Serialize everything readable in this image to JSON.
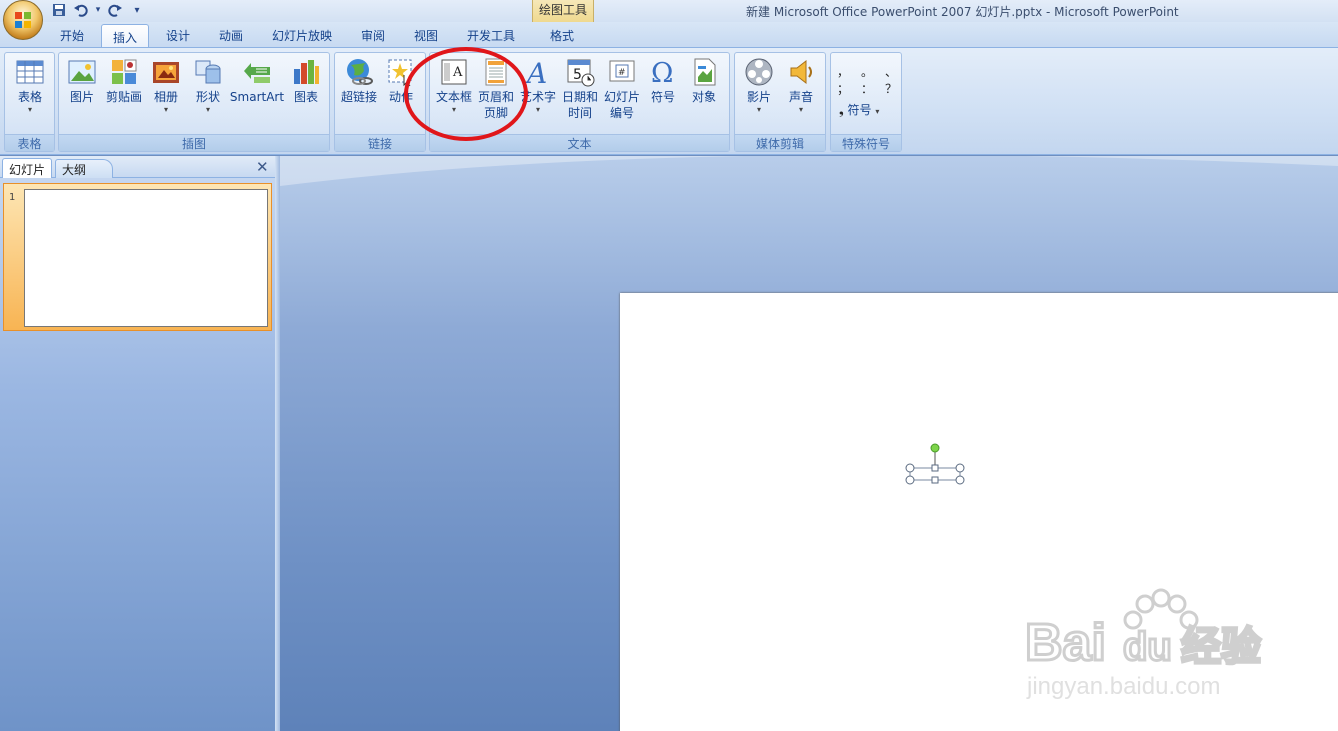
{
  "window": {
    "title": "新建 Microsoft Office PowerPoint 2007 幻灯片.pptx - Microsoft PowerPoint"
  },
  "quick_access": {
    "items": [
      "save-icon",
      "undo-icon",
      "redo-icon",
      "customize-icon"
    ],
    "dropdown": "▾"
  },
  "contextual_tab": {
    "label": "绘图工具",
    "color": "#efd98f"
  },
  "tabs": [
    {
      "label": "开始"
    },
    {
      "label": "插入",
      "active": true
    },
    {
      "label": "设计"
    },
    {
      "label": "动画"
    },
    {
      "label": "幻灯片放映"
    },
    {
      "label": "审阅"
    },
    {
      "label": "视图"
    },
    {
      "label": "开发工具"
    },
    {
      "label": "格式"
    }
  ],
  "ribbon": {
    "groups": [
      {
        "label": "表格",
        "buttons": [
          {
            "label": "表格",
            "icon": "table-icon",
            "has_dropdown": true
          }
        ]
      },
      {
        "label": "插图",
        "buttons": [
          {
            "label": "图片",
            "icon": "picture-icon"
          },
          {
            "label": "剪贴画",
            "icon": "clipart-icon"
          },
          {
            "label": "相册",
            "icon": "photo-album-icon",
            "has_dropdown": true
          },
          {
            "label": "形状",
            "icon": "shapes-icon",
            "has_dropdown": true
          },
          {
            "label": "SmartArt",
            "icon": "smartart-icon"
          },
          {
            "label": "图表",
            "icon": "chart-icon"
          }
        ]
      },
      {
        "label": "链接",
        "buttons": [
          {
            "label": "超链接",
            "icon": "hyperlink-icon"
          },
          {
            "label": "动作",
            "icon": "action-icon"
          }
        ]
      },
      {
        "label": "文本",
        "buttons": [
          {
            "label": "文本框",
            "icon": "textbox-icon",
            "has_dropdown": true
          },
          {
            "label": "页眉和\n页脚",
            "line1": "页眉和",
            "line2": "页脚",
            "icon": "header-footer-icon"
          },
          {
            "label": "艺术字",
            "icon": "wordart-icon",
            "has_dropdown": true
          },
          {
            "label": "日期和\n时间",
            "line1": "日期和",
            "line2": "时间",
            "icon": "date-time-icon"
          },
          {
            "label": "幻灯片\n编号",
            "line1": "幻灯片",
            "line2": "编号",
            "icon": "slide-number-icon"
          },
          {
            "label": "符号",
            "icon": "symbol-icon"
          },
          {
            "label": "对象",
            "icon": "object-icon"
          }
        ]
      },
      {
        "label": "媒体剪辑",
        "buttons": [
          {
            "label": "影片",
            "icon": "movie-icon",
            "has_dropdown": true
          },
          {
            "label": "声音",
            "icon": "sound-icon",
            "has_dropdown": true
          }
        ]
      },
      {
        "label": "特殊符号",
        "symbols_row1": [
          "，",
          "。",
          "、"
        ],
        "symbols_row2": [
          "；",
          "：",
          "？"
        ],
        "button": {
          "label": "符号",
          "prefix": "❟"
        }
      }
    ]
  },
  "slide_panel": {
    "tabs": [
      {
        "label": "幻灯片",
        "active": true
      },
      {
        "label": "大纲"
      }
    ],
    "close_glyph": "✕",
    "slides": [
      {
        "number": "1"
      }
    ]
  },
  "annotation": {
    "color": "#e0161a"
  },
  "watermark": {
    "text1": "Bai",
    "text2": "du",
    "text3": "经验",
    "url": "jingyan.baidu.com"
  }
}
